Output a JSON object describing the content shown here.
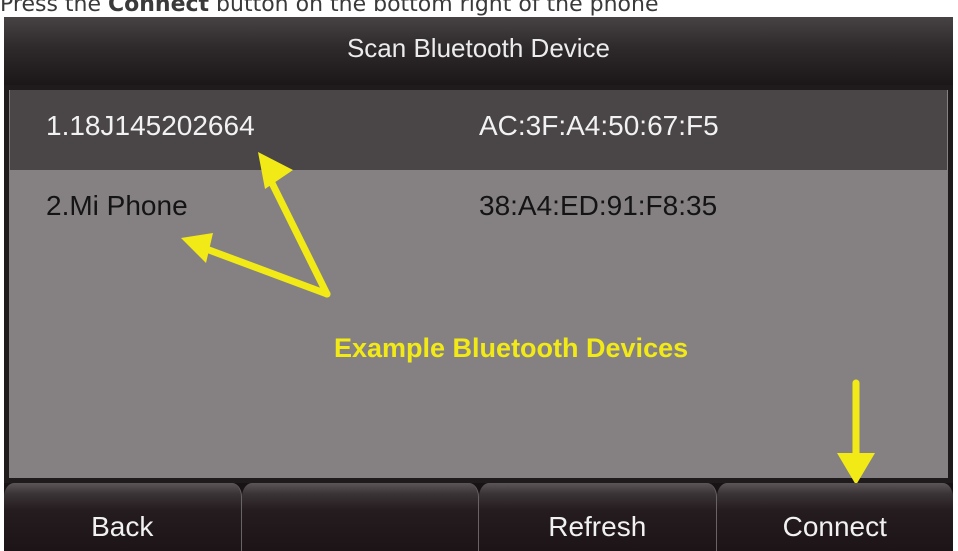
{
  "instruction": {
    "prefix": "Press the ",
    "bold": "Connect",
    "suffix": " button on the bottom right of the phone"
  },
  "screen": {
    "title": "Scan Bluetooth Device",
    "devices": [
      {
        "name": "1.18J145202664",
        "mac": "AC:3F:A4:50:67:F5",
        "selected": true
      },
      {
        "name": "2.Mi Phone",
        "mac": "38:A4:ED:91:F8:35",
        "selected": false
      }
    ],
    "annotation": "Example Bluetooth Devices",
    "softkeys": [
      "Back",
      "",
      "Refresh",
      "Connect"
    ]
  },
  "colors": {
    "annotation": "#f2ea16",
    "selected_row": "#4a4648",
    "list_background": "#858182"
  }
}
